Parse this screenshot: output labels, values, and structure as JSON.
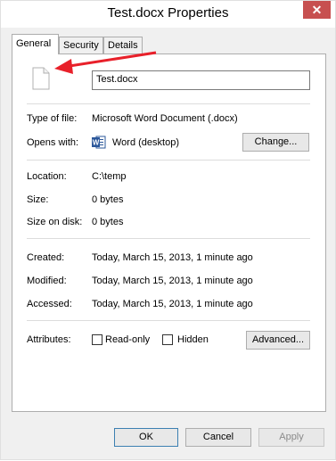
{
  "window": {
    "title": "Test.docx Properties",
    "close_label": "✕"
  },
  "tabs": [
    {
      "label": "General"
    },
    {
      "label": "Security"
    },
    {
      "label": "Details"
    }
  ],
  "general": {
    "filename": "Test.docx",
    "type_label": "Type of file:",
    "type_value": "Microsoft Word Document (.docx)",
    "opens_label": "Opens with:",
    "opens_value": "Word (desktop)",
    "change_button": "Change...",
    "location_label": "Location:",
    "location_value": "C:\\temp",
    "size_label": "Size:",
    "size_value": "0 bytes",
    "size_on_disk_label": "Size on disk:",
    "size_on_disk_value": "0 bytes",
    "created_label": "Created:",
    "created_value": "Today, March 15, 2013, 1 minute ago",
    "modified_label": "Modified:",
    "modified_value": "Today, March 15, 2013, 1 minute ago",
    "accessed_label": "Accessed:",
    "accessed_value": "Today, March 15, 2013, 1 minute ago",
    "attributes_label": "Attributes:",
    "readonly_label": "Read-only",
    "hidden_label": "Hidden",
    "advanced_button": "Advanced..."
  },
  "footer": {
    "ok": "OK",
    "cancel": "Cancel",
    "apply": "Apply"
  },
  "colors": {
    "close_bg": "#c75050",
    "arrow": "#e8202a",
    "word_blue": "#2b579a"
  }
}
